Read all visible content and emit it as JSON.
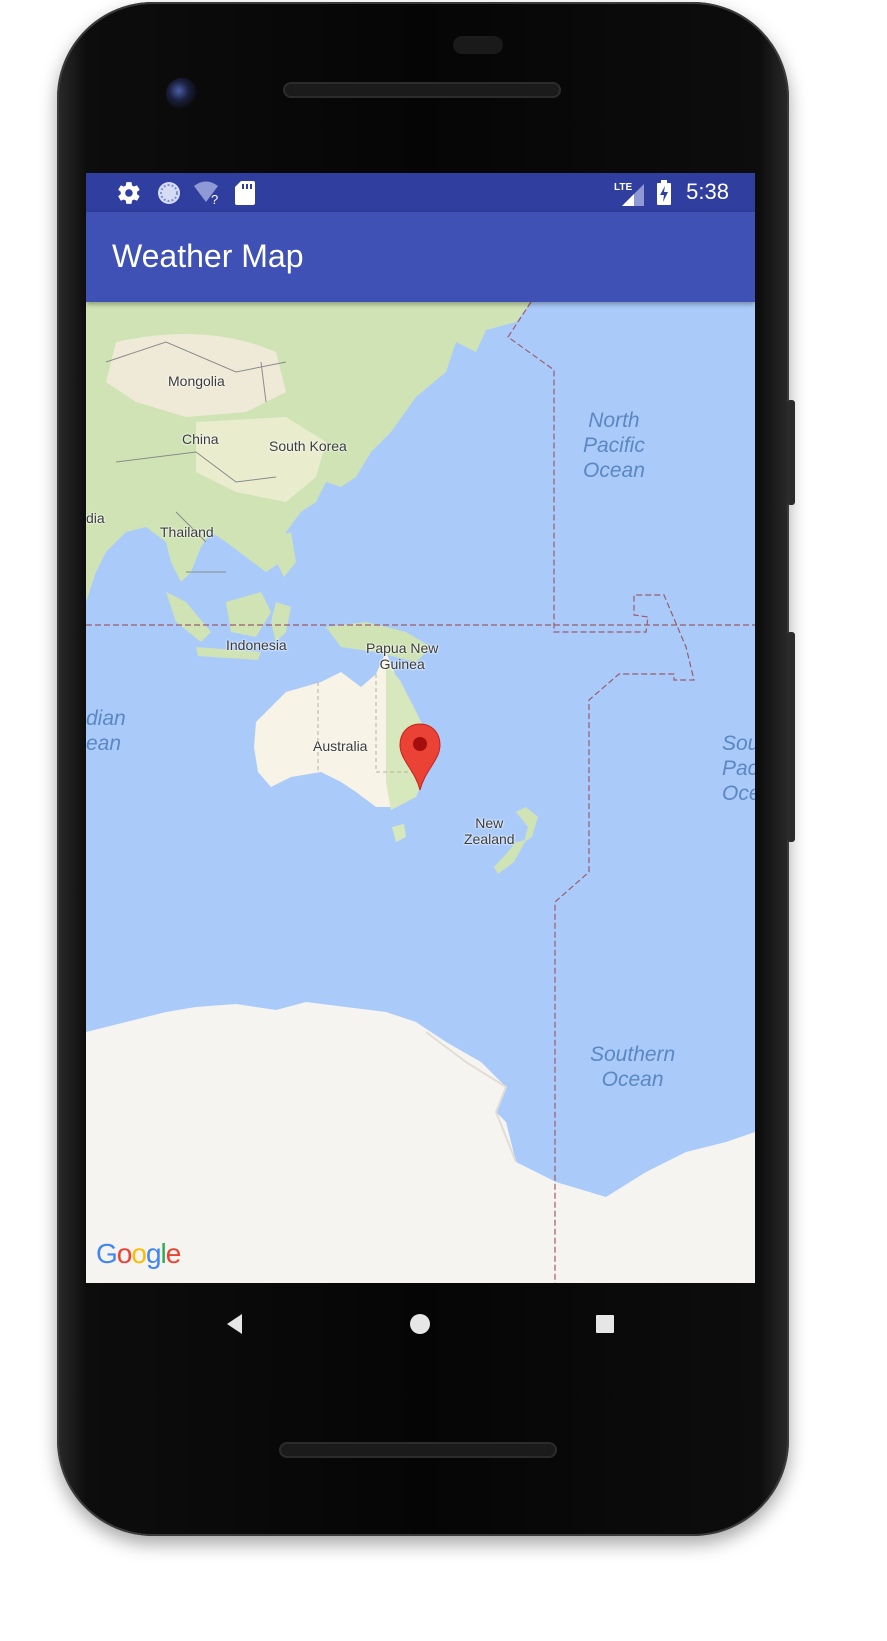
{
  "status_bar": {
    "time": "5:38",
    "network_type": "LTE",
    "icons": [
      "gear-icon",
      "sync-icon",
      "wifi-unknown-icon",
      "sd-card-icon",
      "signal-icon",
      "battery-charging-icon"
    ]
  },
  "app_bar": {
    "title": "Weather Map"
  },
  "map": {
    "labels": {
      "mongolia": "Mongolia",
      "china": "China",
      "south_korea": "South Korea",
      "india": "dia",
      "thailand": "Thailand",
      "indonesia": "Indonesia",
      "papua_line1": "Papua New",
      "papua_line2": "Guinea",
      "australia": "Australia",
      "nz_line1": "New",
      "nz_line2": "Zealand"
    },
    "oceans": {
      "north_pacific_1": "North",
      "north_pacific_2": "Pacific",
      "north_pacific_3": "Ocean",
      "indian_1": "dian",
      "indian_2": "ean",
      "south_pacific_1": "Sou",
      "south_pacific_2": "Pac",
      "south_pacific_3": "Oce",
      "southern_1": "Southern",
      "southern_2": "Ocean"
    },
    "attribution": [
      "G",
      "o",
      "o",
      "g",
      "l",
      "e"
    ],
    "marker_color": "#ea4335"
  },
  "colors": {
    "status_bar": "#303f9f",
    "app_bar": "#3f51b5",
    "water": "#aacbfa",
    "land": "#f5f1e8",
    "vegetation": "#c8e0b0"
  },
  "navigation": {
    "buttons": [
      "back-button",
      "home-button",
      "recents-button"
    ]
  }
}
